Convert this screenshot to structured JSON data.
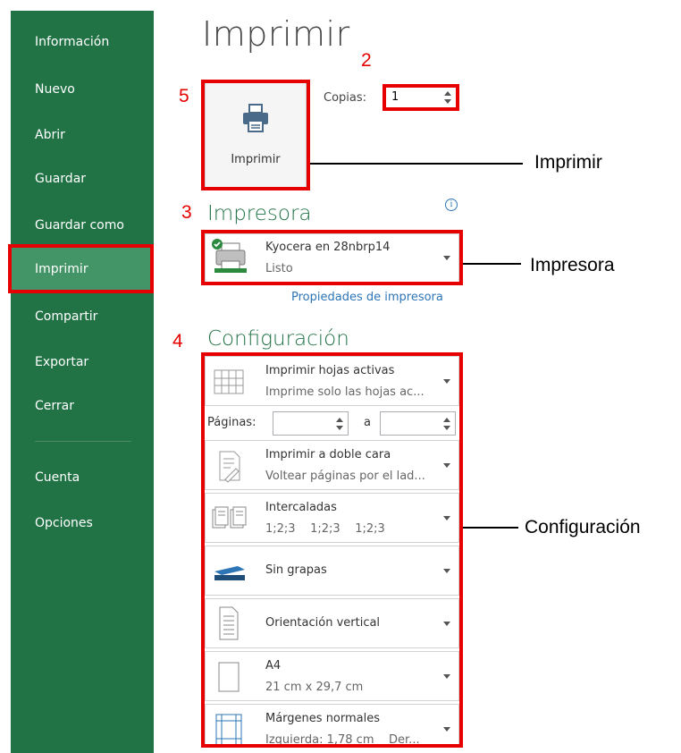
{
  "sidebar": {
    "items": [
      {
        "label": "Información"
      },
      {
        "label": "Nuevo"
      },
      {
        "label": "Abrir"
      },
      {
        "label": "Guardar"
      },
      {
        "label": "Guardar como"
      },
      {
        "label": "Imprimir"
      },
      {
        "label": "Compartir"
      },
      {
        "label": "Exportar"
      },
      {
        "label": "Cerrar"
      },
      {
        "label": "Cuenta"
      },
      {
        "label": "Opciones"
      }
    ]
  },
  "page": {
    "title": "Imprimir",
    "print_button_label": "Imprimir",
    "copies_label": "Copias:",
    "copies_value": "1",
    "printer_heading": "Impresora",
    "printer": {
      "name": "Kyocera en 28nbrp14",
      "status": "Listo"
    },
    "printer_properties_link": "Propiedades de impresora",
    "settings_heading": "Configuración",
    "settings": {
      "scope": {
        "title": "Imprimir hojas activas",
        "subtitle": "Imprime solo las hojas ac..."
      },
      "pages_label": "Páginas:",
      "pages_to": "a",
      "sides": {
        "title": "Imprimir a doble cara",
        "subtitle": "Voltear páginas por el lad..."
      },
      "collation": {
        "title": "Intercaladas",
        "subtitle": "1;2;3    1;2;3    1;2;3"
      },
      "staple": {
        "title": "Sin grapas"
      },
      "orientation": {
        "title": "Orientación vertical"
      },
      "paper": {
        "title": "A4",
        "subtitle": "21 cm x 29,7 cm"
      },
      "margins": {
        "title": "Márgenes normales",
        "subtitle": "Izquierda: 1,78 cm    Der..."
      }
    }
  },
  "annotations": {
    "numbers": [
      "2",
      "5",
      "3",
      "4"
    ],
    "callouts": [
      "Imprimir",
      "Impresora",
      "Configuración"
    ]
  },
  "colors": {
    "sidebar": "#217346",
    "active": "#439467",
    "highlight": "#e60000",
    "heading": "#217346"
  }
}
